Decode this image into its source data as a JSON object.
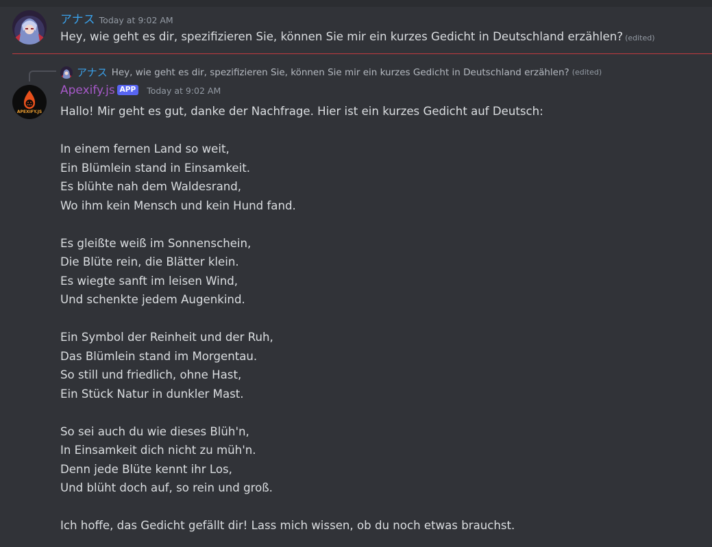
{
  "message1": {
    "username": "アナス",
    "timestamp": "Today at 9:02 AM",
    "text": "Hey, wie geht es dir, spezifizieren Sie, können Sie mir ein kurzes Gedicht in Deutschland erzählen?",
    "edited": "(edited)",
    "name_color": "#3aa0e8"
  },
  "reply_preview": {
    "username": "アナス",
    "text": "Hey, wie geht es dir, spezifizieren Sie, können Sie mir ein kurzes Gedicht in Deutschland erzählen?",
    "edited": "(edited)"
  },
  "message2": {
    "username": "Apexify.js",
    "badge": "APP",
    "timestamp": "Today at 9:02 AM",
    "avatar_text": "APEXIFY.JS",
    "name_color": "#a659c8",
    "lines": [
      "Hallo! Mir geht es gut, danke der Nachfrage. Hier ist ein kurzes Gedicht auf Deutsch:",
      "",
      "In einem fernen Land so weit,",
      "Ein Blümlein stand in Einsamkeit.",
      "Es blühte nah dem Waldesrand,",
      "Wo ihm kein Mensch und kein Hund fand.",
      "",
      "Es gleißte weiß im Sonnenschein,",
      "Die Blüte rein, die Blätter klein.",
      "Es wiegte sanft im leisen Wind,",
      "Und schenkte jedem Augenkind.",
      "",
      "Ein Symbol der Reinheit und der Ruh,",
      "Das Blümlein stand im Morgentau.",
      "So still und friedlich, ohne Hast,",
      "Ein Stück Natur in dunkler Mast.",
      "",
      "So sei auch du wie dieses Blüh'n,",
      "In Einsamkeit dich nicht zu müh'n.",
      "Denn jede Blüte kennt ihr Los,",
      "Und blüht doch auf, so rein und groß.",
      "",
      "Ich hoffe, das Gedicht gefällt dir! Lass mich wissen, ob du noch etwas brauchst."
    ]
  }
}
